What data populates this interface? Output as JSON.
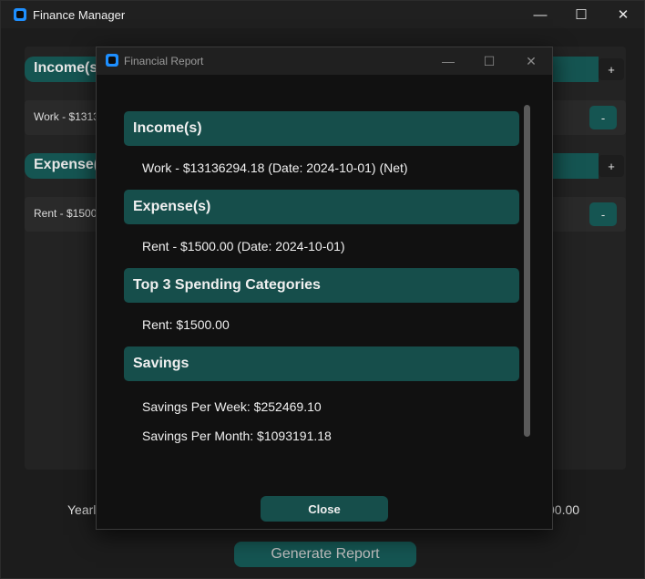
{
  "main_window": {
    "title": "Finance Manager",
    "controls": {
      "minimize": "—",
      "maximize": "☐",
      "close": "✕"
    },
    "income_header": "Income(s",
    "income_add": "+",
    "income_row": "Work - $1313",
    "income_remove": "-",
    "expense_header": "Expense(",
    "expense_add": "+",
    "expense_row": "Rent - $1500",
    "expense_remove": "-",
    "yearly_left": "Yearl",
    "yearly_right": "00.00",
    "generate_button": "Generate Report"
  },
  "report_window": {
    "title": "Financial Report",
    "controls": {
      "minimize": "—",
      "maximize": "☐",
      "close": "✕"
    },
    "sections": [
      {
        "header": "Income(s)",
        "lines": [
          "Work - $13136294.18 (Date: 2024-10-01) (Net)"
        ]
      },
      {
        "header": "Expense(s)",
        "lines": [
          "Rent - $1500.00 (Date: 2024-10-01)"
        ]
      },
      {
        "header": "Top 3 Spending Categories",
        "lines": [
          "Rent: $1500.00"
        ]
      },
      {
        "header": "Savings",
        "lines": [
          "Savings Per Week: $252469.10",
          "Savings Per Month: $1093191.18"
        ]
      }
    ],
    "close_button": "Close"
  },
  "colors": {
    "accent": "#155552",
    "app_icon": "#1e8fff",
    "background": "#1c1c1c"
  }
}
